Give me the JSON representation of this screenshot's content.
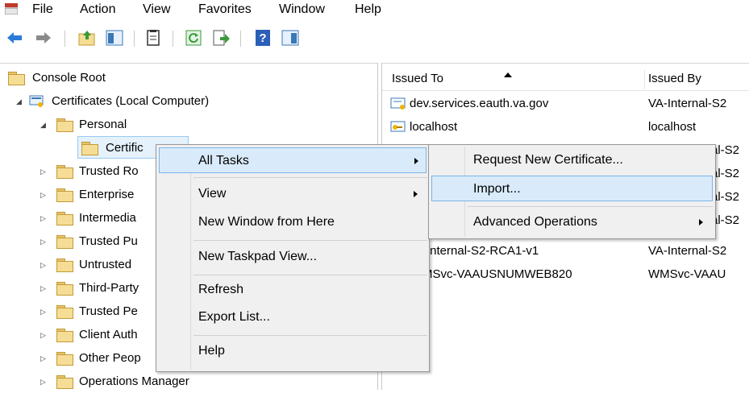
{
  "menu_bar": [
    "File",
    "Action",
    "View",
    "Favorites",
    "Window",
    "Help"
  ],
  "toolbar": {
    "buttons": [
      "back-arrow-icon",
      "forward-arrow-icon",
      "up-folder-icon",
      "show-hide-tree-icon",
      "properties-icon",
      "refresh-icon",
      "export-list-icon",
      "help-icon",
      "action-pane-icon"
    ]
  },
  "tree": {
    "root": "Console Root",
    "computer": "Certificates (Local Computer)",
    "personal": "Personal",
    "certificates": "Certific",
    "folders": [
      "Trusted Ro",
      "Enterprise",
      "Intermedia",
      "Trusted Pu",
      "Untrusted",
      "Third-Party",
      "Trusted Pe",
      "Client Auth",
      "Other Peop",
      "Operations Manager"
    ]
  },
  "list": {
    "columns": [
      "Issued To",
      "Issued By"
    ],
    "rows": [
      {
        "issued_to": "dev.services.eauth.va.gov",
        "issued_by": "VA-Internal-S2"
      },
      {
        "issued_to": "localhost",
        "issued_by": "localhost"
      },
      {
        "issued_to": "",
        "issued_by": "al-S2"
      },
      {
        "issued_to": "",
        "issued_by": "al-S2"
      },
      {
        "issued_to": "",
        "issued_by": "al-S2"
      },
      {
        "issued_to": "",
        "issued_by": "al-S2"
      },
      {
        "issued_to": "-Internal-S2-RCA1-v1",
        "issued_by": "VA-Internal-S2"
      },
      {
        "issued_to": "MSvc-VAAUSNUMWEB820",
        "issued_by": "WMSvc-VAAU"
      }
    ]
  },
  "context_menu": {
    "items": [
      "All Tasks",
      "View",
      "New Window from Here",
      "New Taskpad View...",
      "Refresh",
      "Export List...",
      "Help"
    ]
  },
  "submenu": {
    "items": [
      "Request New Certificate...",
      "Import...",
      "Advanced Operations"
    ]
  }
}
